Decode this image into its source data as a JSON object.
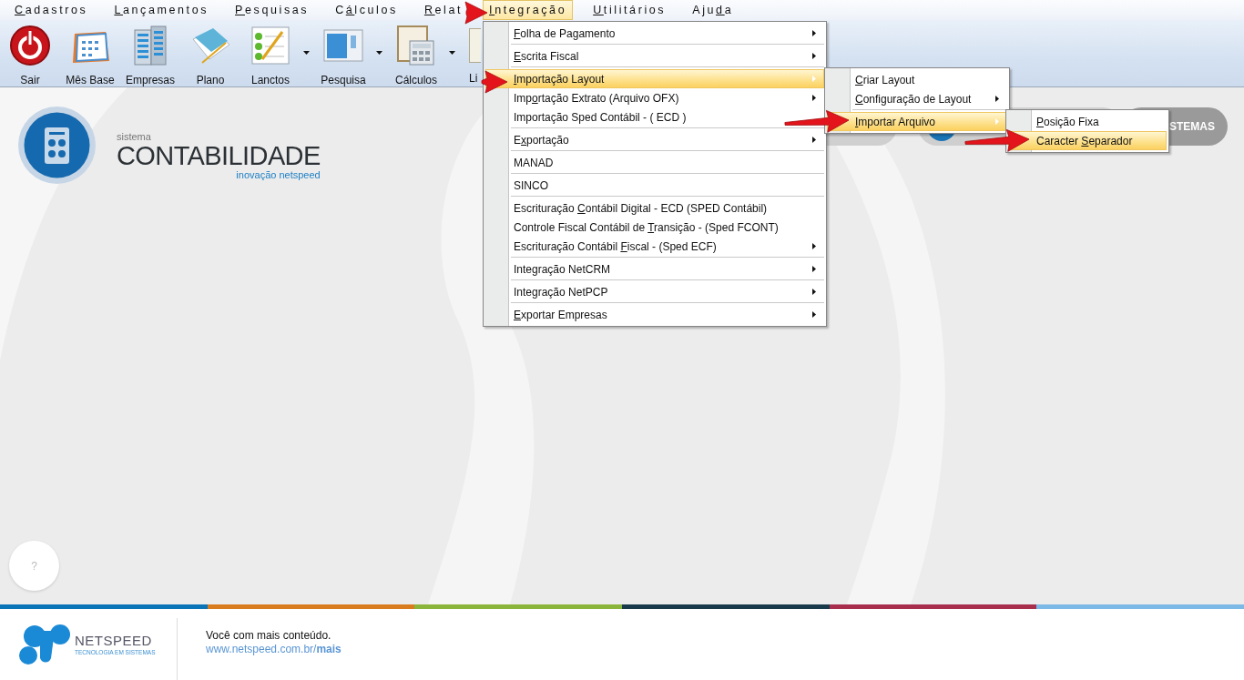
{
  "menubar": {
    "items": [
      {
        "label": "Cadastros",
        "selected": false
      },
      {
        "label": "Lançamentos",
        "selected": false
      },
      {
        "label": "Pesquisas",
        "selected": false
      },
      {
        "label": "Cálculos",
        "selected": false
      },
      {
        "label": "Relat",
        "selected": false
      },
      {
        "label": "Integração",
        "selected": true
      },
      {
        "label": "Utilitários",
        "selected": false
      },
      {
        "label": "Ajuda",
        "selected": false
      }
    ]
  },
  "toolbar": {
    "buttons": [
      {
        "label": "Sair",
        "dropdown": false
      },
      {
        "label": "Mês Base",
        "dropdown": false
      },
      {
        "label": "Empresas",
        "dropdown": false
      },
      {
        "label": "Plano",
        "dropdown": false
      },
      {
        "label": "Lanctos",
        "dropdown": true
      },
      {
        "label": "Pesquisa",
        "dropdown": true
      },
      {
        "label": "Cálculos",
        "dropdown": true
      },
      {
        "label": "Li",
        "dropdown": false
      }
    ]
  },
  "menus": [
    {
      "groups": [
        [
          {
            "label": "Folha de Pagamento",
            "submenu": true,
            "selected": false
          }
        ],
        [
          {
            "label": "Escrita Fiscal",
            "submenu": true,
            "selected": false
          }
        ],
        [
          {
            "label": "Importação Layout",
            "submenu": true,
            "selected": true
          },
          {
            "label": "Importação Extrato (Arquivo OFX)",
            "submenu": true,
            "selected": false
          },
          {
            "label": "Importação Sped Contábil - ( ECD )",
            "submenu": false,
            "selected": false
          }
        ],
        [
          {
            "label": "Exportação",
            "submenu": true,
            "selected": false
          }
        ],
        [
          {
            "label": "MANAD",
            "submenu": false,
            "selected": false
          }
        ],
        [
          {
            "label": "SINCO",
            "submenu": false,
            "selected": false
          }
        ],
        [
          {
            "label": "Escrituração Contábil Digital - ECD (SPED Contábil)",
            "submenu": false,
            "selected": false
          },
          {
            "label": "Controle Fiscal Contábil de Transição - (Sped FCONT)",
            "submenu": false,
            "selected": false
          },
          {
            "label": "Escrituração Contábil Fiscal - (Sped ECF)",
            "submenu": true,
            "selected": false
          }
        ],
        [
          {
            "label": "Integração NetCRM",
            "submenu": true,
            "selected": false
          }
        ],
        [
          {
            "label": "Integração NetPCP",
            "submenu": true,
            "selected": false
          }
        ],
        [
          {
            "label": "Exportar Empresas",
            "submenu": true,
            "selected": false
          }
        ]
      ]
    },
    {
      "groups": [
        [
          {
            "label": "Criar Layout",
            "submenu": false,
            "selected": false
          },
          {
            "label": "Configuração de Layout",
            "submenu": true,
            "selected": false
          }
        ],
        [
          {
            "label": "Importar Arquivo",
            "submenu": true,
            "selected": true
          }
        ]
      ]
    },
    {
      "groups": [
        [
          {
            "label": "Posição Fixa",
            "submenu": false,
            "selected": false
          },
          {
            "label": "Caracter Separador",
            "submenu": false,
            "selected": true
          }
        ]
      ]
    }
  ],
  "branding": {
    "caption": "sistema",
    "title": "CONTABILIDADE",
    "subtitle": "inovação netspeed"
  },
  "banner": {
    "button_label": "STEMAS"
  },
  "help_button": {
    "label": "?"
  },
  "footer": {
    "brand": "NETSPEED",
    "tagline": "TECNOLOGIA EM SISTEMAS",
    "message": "Você com mais conteúdo.",
    "link": "www.netspeed.com.br/**mais**"
  }
}
